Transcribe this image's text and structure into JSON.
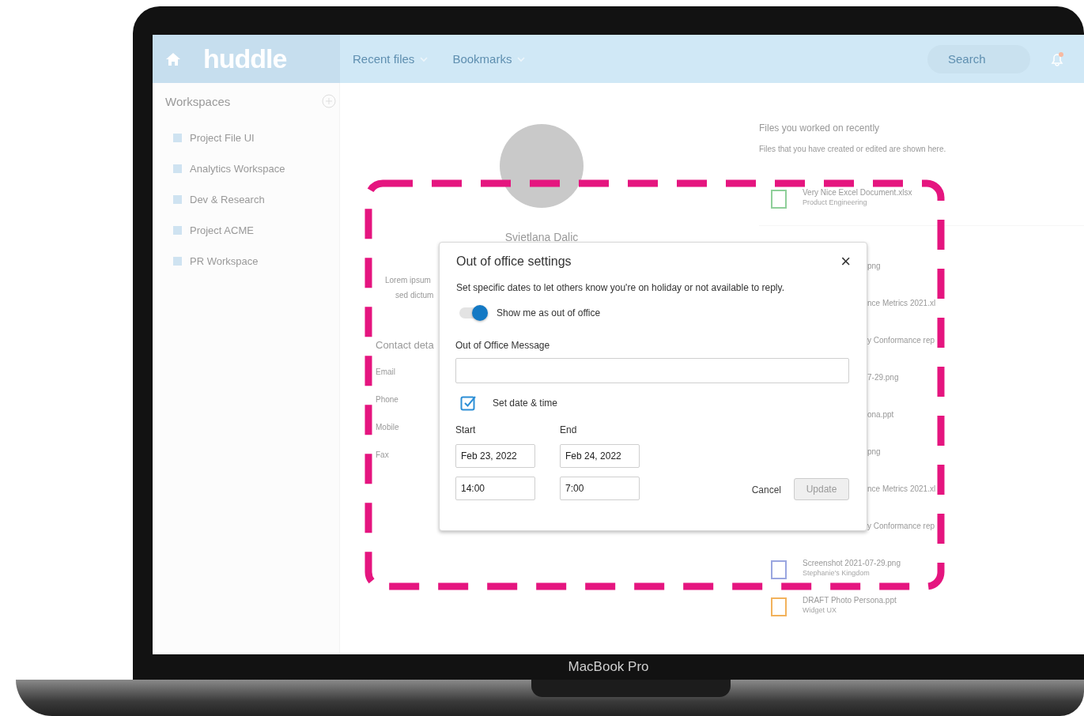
{
  "header": {
    "logo": "huddle",
    "nav": [
      {
        "label": "Recent files"
      },
      {
        "label": "Bookmarks"
      }
    ],
    "search": {
      "placeholder": "Search"
    }
  },
  "sidebar": {
    "title": "Workspaces",
    "items": [
      {
        "label": "Project File UI"
      },
      {
        "label": "Analytics Workspace"
      },
      {
        "label": "Dev & Research"
      },
      {
        "label": "Project ACME"
      },
      {
        "label": "PR Workspace"
      }
    ]
  },
  "profile": {
    "name": "Svietlana Dalic",
    "bio": [
      "Lorem ipsum",
      "sed dictum"
    ],
    "contact_title": "Contact deta",
    "contact_fields": [
      "Email",
      "Phone",
      "Mobile",
      "Fax"
    ]
  },
  "recent_files": {
    "title": "Files you worked on recently",
    "subtitle": "Files that you have created or edited are shown here.",
    "files": [
      {
        "kind": "full",
        "name": "Very Nice Excel Document.xlsx",
        "workspace": "Product Engineering",
        "color": "#8fcf9a"
      },
      {
        "kind": "covered",
        "name": "png"
      },
      {
        "kind": "covered",
        "name": "nce Metrics 2021.xl"
      },
      {
        "kind": "covered",
        "name": "y Conformance rep"
      },
      {
        "kind": "covered",
        "name": "7-29.png"
      },
      {
        "kind": "covered",
        "name": "ona.ppt"
      },
      {
        "kind": "covered",
        "name": "png"
      },
      {
        "kind": "covered",
        "name": "nce Metrics 2021.xl"
      },
      {
        "kind": "covered",
        "name": "y Conformance rep"
      },
      {
        "kind": "full",
        "name": "Screenshot 2021-07-29.png",
        "workspace": "Stephanie's Kingdom",
        "color": "#9aa6e0"
      },
      {
        "kind": "full",
        "name": "DRAFT Photo Persona.ppt",
        "workspace": "Widget UX",
        "color": "#f2b25c"
      }
    ]
  },
  "dialog": {
    "title": "Out of office settings",
    "close": "×",
    "description": "Set specific dates to let others know you're on holiday or not available to reply.",
    "toggle": {
      "label": "Show me as out of office",
      "on": true
    },
    "message_label": "Out of Office Message",
    "date_time": {
      "label": "Set date & time",
      "checked": true
    },
    "ranges": [
      {
        "label": "Start",
        "date": "Feb 23, 2022",
        "time": "14:00"
      },
      {
        "label": "End",
        "date": "Feb 24, 2022",
        "time": "7:00"
      }
    ],
    "buttons": [
      {
        "label": "Cancel",
        "kind": "text",
        "disabled": false
      },
      {
        "label": "Update",
        "kind": "primary",
        "disabled": true
      }
    ]
  },
  "device": {
    "label": "MacBook Pro"
  }
}
